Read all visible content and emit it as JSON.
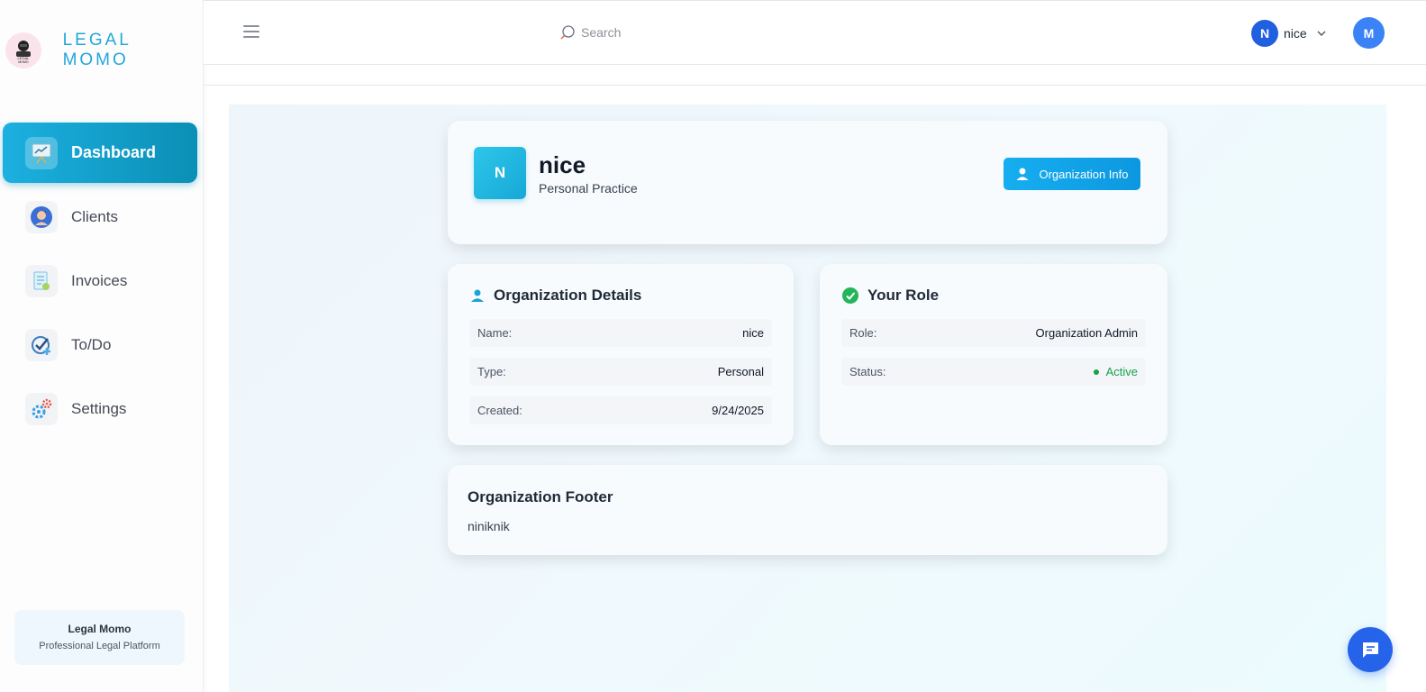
{
  "brand": {
    "name": "LEGAL MOMO",
    "logo_text": "LEGAL MOMO"
  },
  "nav": {
    "items": [
      {
        "label": "Dashboard",
        "icon": "presentation-chart-icon",
        "active": true
      },
      {
        "label": "Clients",
        "icon": "person-icon",
        "active": false
      },
      {
        "label": "Invoices",
        "icon": "invoice-icon",
        "active": false
      },
      {
        "label": "To/Do",
        "icon": "check-plus-icon",
        "active": false
      },
      {
        "label": "Settings",
        "icon": "gears-icon",
        "active": false
      }
    ]
  },
  "sidebar_footer": {
    "title": "Legal Momo",
    "subtitle": "Professional Legal Platform"
  },
  "header": {
    "search_label": "Search",
    "user": {
      "initial": "N",
      "name": "nice"
    },
    "profile_initial": "M"
  },
  "org": {
    "initial": "N",
    "name": "nice",
    "type_label": "Personal Practice",
    "button_label": "Organization Info"
  },
  "details": {
    "title": "Organization Details",
    "rows": [
      {
        "key": "Name:",
        "value": "nice"
      },
      {
        "key": "Type:",
        "value": "Personal"
      },
      {
        "key": "Created:",
        "value": "9/24/2025"
      }
    ]
  },
  "role": {
    "title": "Your Role",
    "rows": [
      {
        "key": "Role:",
        "value": "Organization Admin"
      },
      {
        "key": "Status:",
        "value": "Active"
      }
    ]
  },
  "footer": {
    "title": "Organization Footer",
    "text": "niniknik"
  },
  "colors": {
    "accent": "#16a8d6",
    "active_status": "#16a34a",
    "primary_blue": "#2563eb"
  }
}
